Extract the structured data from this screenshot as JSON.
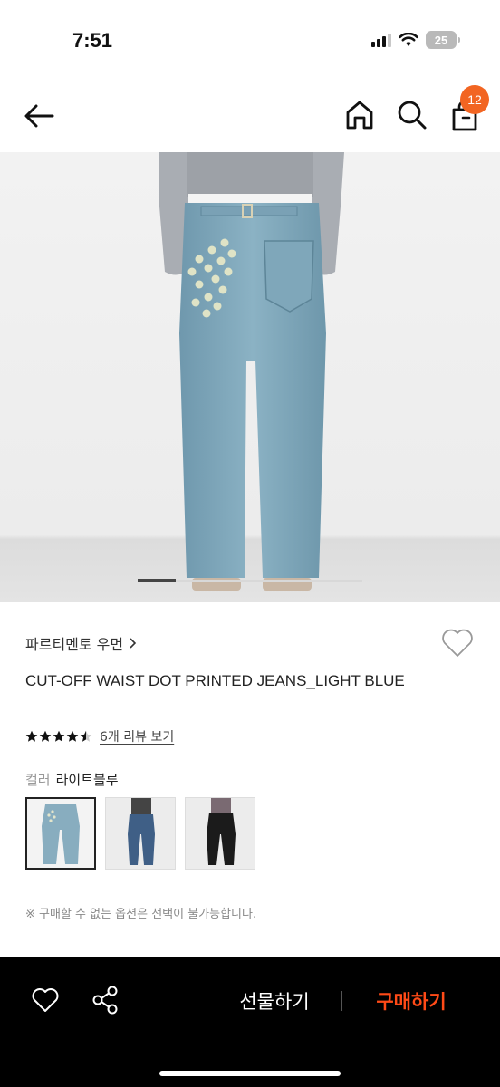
{
  "status": {
    "time": "7:51",
    "battery": "25",
    "icons": [
      "signal-icon",
      "wifi-icon",
      "battery-icon"
    ]
  },
  "nav": {
    "icons": [
      "back-arrow-icon",
      "home-icon",
      "search-icon",
      "shopping-bag-icon"
    ],
    "cart_count": "12"
  },
  "product": {
    "brand": "파르티멘토 우먼",
    "title": "CUT-OFF WAIST DOT PRINTED JEANS_LIGHT BLUE",
    "rating": 4.5,
    "review_link": "6개 리뷰 보기",
    "color_label": "컬러",
    "color_value": "라이트블루",
    "swatches": [
      "light-blue-jeans",
      "dark-blue-jeans",
      "black-jeans"
    ],
    "selected_swatch": 0,
    "notice": "※ 구매할 수 없는 옵션은 선택이 불가능합니다."
  },
  "bottom_bar": {
    "gift_label": "선물하기",
    "buy_label": "구매하기",
    "icons": [
      "heart-icon",
      "share-icon"
    ]
  },
  "colors": {
    "accent": "#f26522",
    "buy": "#ff4a17",
    "denim": "#7ea7bb"
  }
}
